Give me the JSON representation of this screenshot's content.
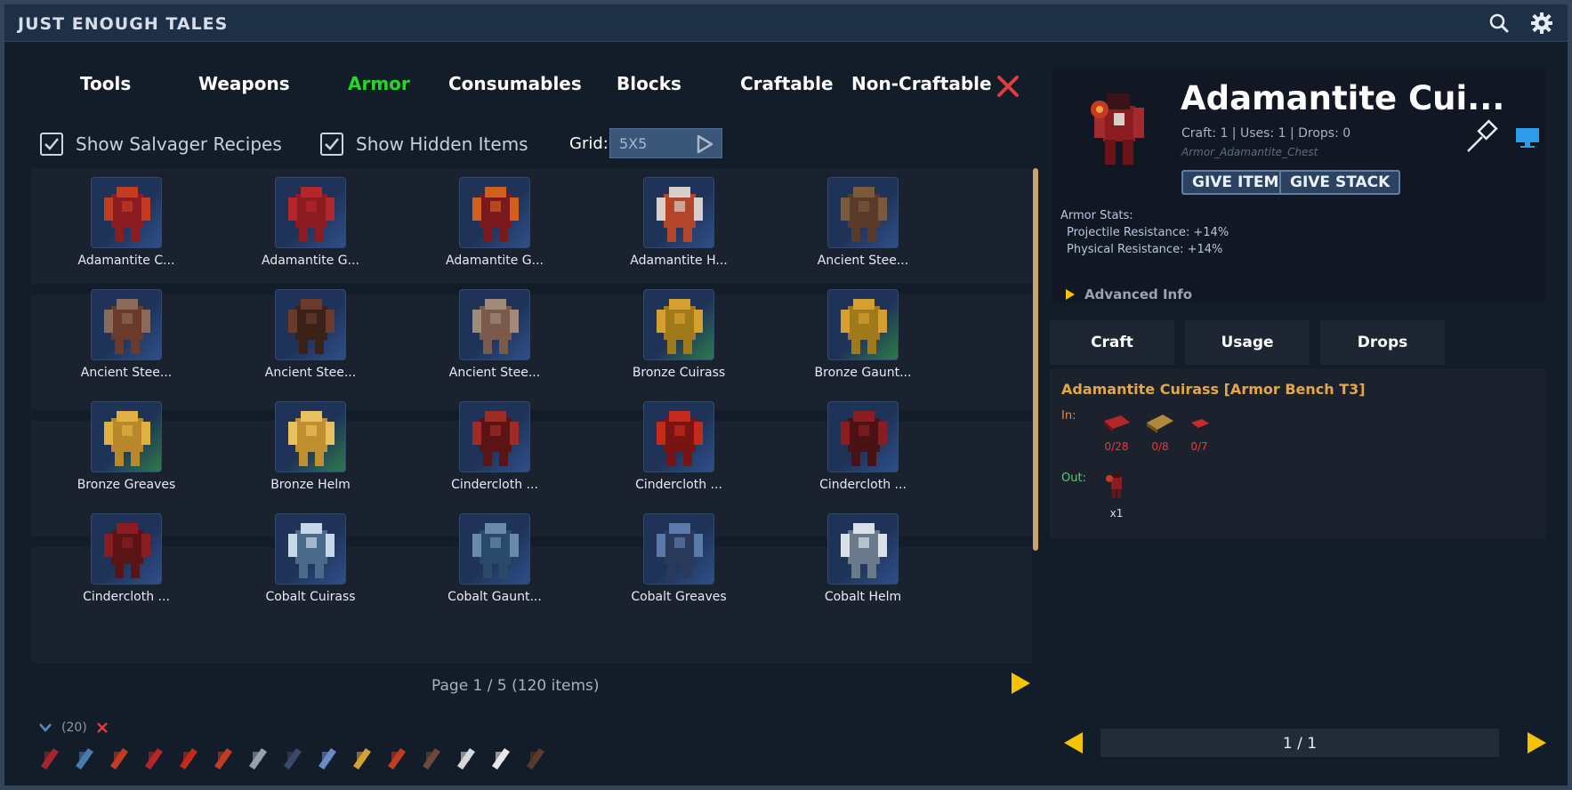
{
  "app": {
    "title": "JUST ENOUGH TALES"
  },
  "tabs": [
    "Tools",
    "Weapons",
    "Armor",
    "Consumables",
    "Blocks",
    "Craftable",
    "Non-Craftable"
  ],
  "active_tab": "Armor",
  "options": {
    "salvager_label": "Show Salvager Recipes",
    "hidden_label": "Show Hidden Items",
    "grid_label": "Grid:",
    "grid_value": "5X5"
  },
  "items": [
    "Adamantite C...",
    "Adamantite G...",
    "Adamantite G...",
    "Adamantite H...",
    "Ancient Stee...",
    "Ancient Stee...",
    "Ancient Stee...",
    "Ancient Stee...",
    "Bronze Cuirass",
    "Bronze Gaunt...",
    "Bronze Greaves",
    "Bronze Helm",
    "Cindercloth ...",
    "Cindercloth ...",
    "Cindercloth ...",
    "Cindercloth ...",
    "Cobalt Cuirass",
    "Cobalt Gaunt...",
    "Cobalt Greaves",
    "Cobalt Helm"
  ],
  "pager": {
    "text": "Page 1 / 5 (120 items)"
  },
  "recent": {
    "count": "(20)"
  },
  "detail": {
    "name": "Adamantite Cui...",
    "meta": "Craft: 1 | Uses: 1 | Drops: 0",
    "id": "Armor_Adamantite_Chest",
    "give_item": "GIVE ITEM",
    "give_stack": "GIVE STACK",
    "stats_title": "Armor Stats:",
    "stat1": "Projectile Resistance: +14%",
    "stat2": "Physical Resistance: +14%",
    "advanced": "Advanced Info"
  },
  "recipe_tabs": [
    "Craft",
    "Usage",
    "Drops"
  ],
  "recipe": {
    "title": "Adamantite Cuirass [Armor Bench T3]",
    "in_label": "In:",
    "out_label": "Out:",
    "inputs": [
      "0/28",
      "0/8",
      "0/7"
    ],
    "output_count": "x1"
  },
  "recipe_pager": {
    "text": "1 / 1"
  },
  "colors": {
    "accent": "#27d62a",
    "bg": "#131c29",
    "titlebar": "#1d3046",
    "arrow": "#f5c400",
    "close": "#e23b3b",
    "recipe_title": "#e3a64b"
  }
}
